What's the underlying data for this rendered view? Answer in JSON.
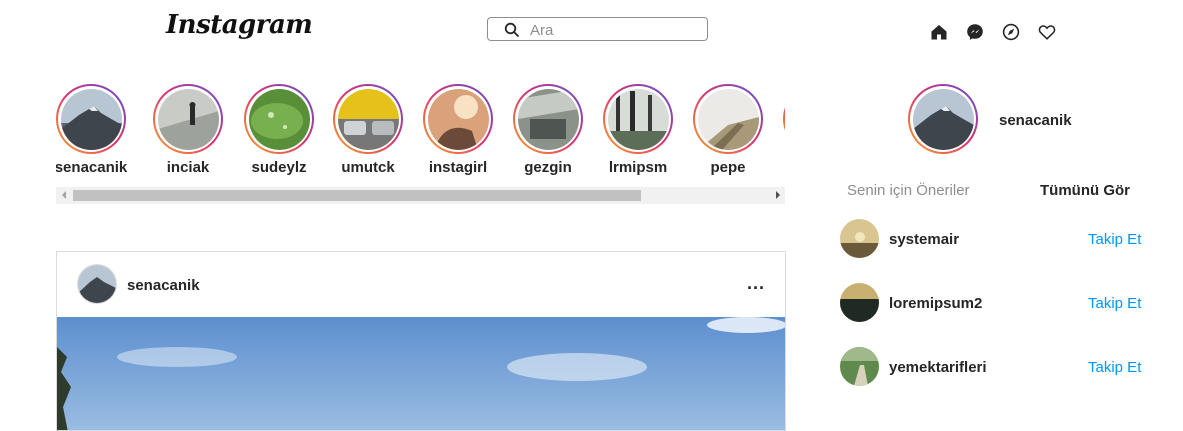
{
  "header": {
    "logo_text": "Instagram",
    "search": {
      "placeholder": "Ara",
      "value": ""
    },
    "nav_icons": [
      "home-icon",
      "messenger-icon",
      "explore-compass-icon",
      "heart-icon"
    ]
  },
  "stories": {
    "items": [
      {
        "username": "senacanik"
      },
      {
        "username": "inciak"
      },
      {
        "username": "sudeylz"
      },
      {
        "username": "umutck"
      },
      {
        "username": "instagirl"
      },
      {
        "username": "gezgin"
      },
      {
        "username": "lrmipsm"
      },
      {
        "username": "pepe"
      }
    ],
    "scroll_position": 0.0
  },
  "post": {
    "username": "senacanik",
    "more_label": "..."
  },
  "sidebar": {
    "current_user": "senacanik",
    "suggestions_title": "Senin için Öneriler",
    "see_all": "Tümünü Gör",
    "suggestions": [
      {
        "username": "systemair",
        "follow_label": "Takip Et"
      },
      {
        "username": "loremipsum2",
        "follow_label": "Takip Et"
      },
      {
        "username": "yemektarifleri",
        "follow_label": "Takip Et"
      }
    ]
  },
  "colors": {
    "link_blue": "#0095f6",
    "ring_gradient": [
      "#f9a825",
      "#e1306c",
      "#5851db"
    ],
    "muted_text": "#8e8e8e"
  }
}
